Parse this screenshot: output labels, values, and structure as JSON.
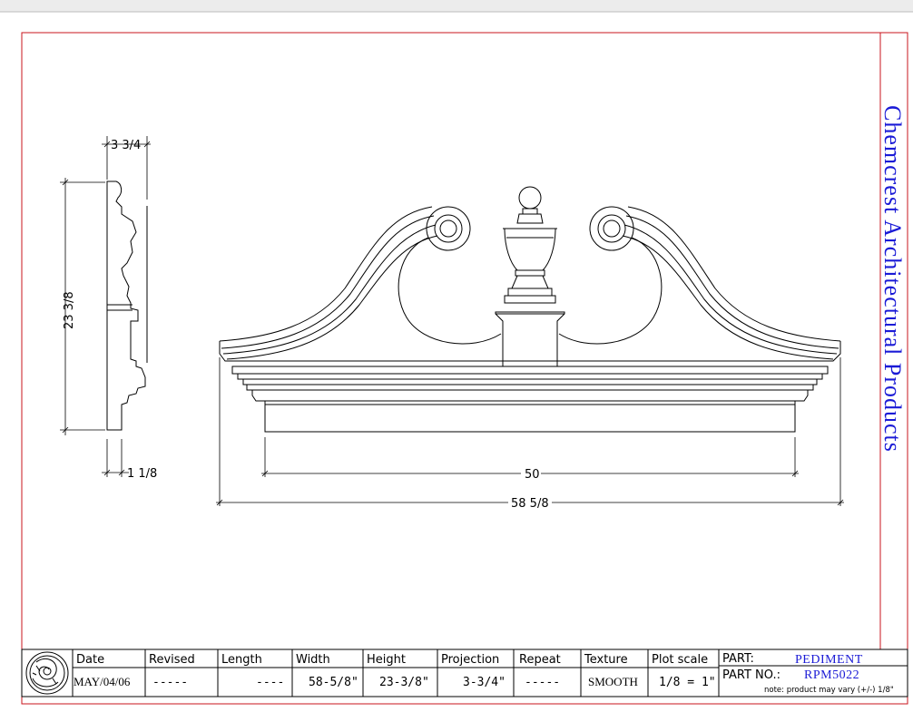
{
  "brand": "Chemcrest Architectural Products",
  "dimensions": {
    "side_depth": "3 3/4",
    "side_height": "23 3/8",
    "side_bottom": "1 1/8",
    "inner_width": "50",
    "overall_width": "58 5/8"
  },
  "title_block": {
    "headers": [
      "Date",
      "Revised",
      "Length",
      "Width",
      "Height",
      "Projection",
      "Repeat",
      "Texture",
      "Plot scale"
    ],
    "values": [
      "MAY/04/06",
      "-----",
      "----",
      "58-5/8\"",
      "23-3/8\"",
      "3-3/4\"",
      "-----",
      "SMOOTH",
      "1/8 = 1\""
    ],
    "part_label": "PART:",
    "part_value": "PEDIMENT",
    "part_no_label": "PART NO.:",
    "part_no_value": "RPM5022",
    "note": "note: product may vary (+/-) 1/8\""
  },
  "colors": {
    "border": "#c8141e",
    "brand": "#1a1ad6",
    "ink": "#000000"
  }
}
